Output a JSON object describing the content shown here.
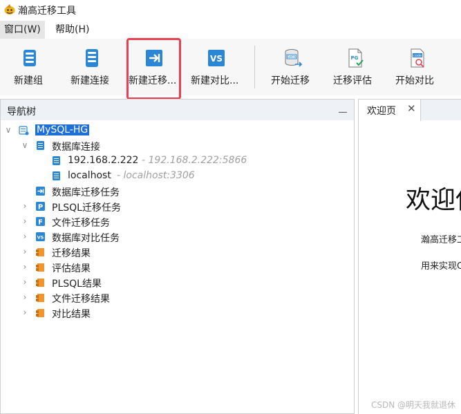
{
  "window": {
    "title": "瀚高迁移工具"
  },
  "menu": {
    "items": [
      {
        "label": "窗口(W)"
      },
      {
        "label": "帮助(H)"
      }
    ]
  },
  "toolbar": {
    "buttons": [
      {
        "label": "新建组",
        "icon": "server-group-icon"
      },
      {
        "label": "新建连接",
        "icon": "server-connection-icon"
      },
      {
        "label": "新建迁移...",
        "icon": "migration-arrow-icon"
      },
      {
        "label": "新建对比...",
        "icon": "vs-compare-icon"
      },
      {
        "label": "开始迁移",
        "icon": "data-transfer-icon"
      },
      {
        "label": "迁移评估",
        "icon": "pg-document-icon"
      },
      {
        "label": "开始对比",
        "icon": "code-compare-icon"
      }
    ],
    "highlight_color": "#e8404f"
  },
  "navigator": {
    "title": "导航树",
    "tree": {
      "root": {
        "label": "MySQL-HG",
        "selected": true
      },
      "db_connections": {
        "label": "数据库连接",
        "items": [
          {
            "label": "192.168.2.222",
            "sub": "- 192.168.2.222:5866"
          },
          {
            "label": "localhost",
            "sub": "- localhost:3306"
          }
        ]
      },
      "tasks": [
        {
          "label": "数据库迁移任务",
          "icon": "migration-arrow-icon",
          "expandable": false
        },
        {
          "label": "PLSQL迁移任务",
          "icon": "p-badge-icon",
          "expandable": true
        },
        {
          "label": "文件迁移任务",
          "icon": "f-badge-icon",
          "expandable": true
        },
        {
          "label": "数据库对比任务",
          "icon": "vs-badge-icon",
          "expandable": true
        }
      ],
      "results": [
        {
          "label": "迁移结果"
        },
        {
          "label": "评估结果"
        },
        {
          "label": "PLSQL结果"
        },
        {
          "label": "文件迁移结果"
        },
        {
          "label": "对比结果"
        }
      ]
    }
  },
  "editor": {
    "tab": {
      "label": "欢迎页",
      "close": "✕"
    },
    "welcome": {
      "heading": "欢迎使",
      "line1": "瀚高迁移工",
      "line2": "用来实现O"
    }
  },
  "watermark": "CSDN @明天我就退休",
  "colors": {
    "accent": "#1e6fd9",
    "icon_blue": "#2b87d6",
    "folder_orange": "#f0962e",
    "panel_header": "#eef1f5"
  }
}
